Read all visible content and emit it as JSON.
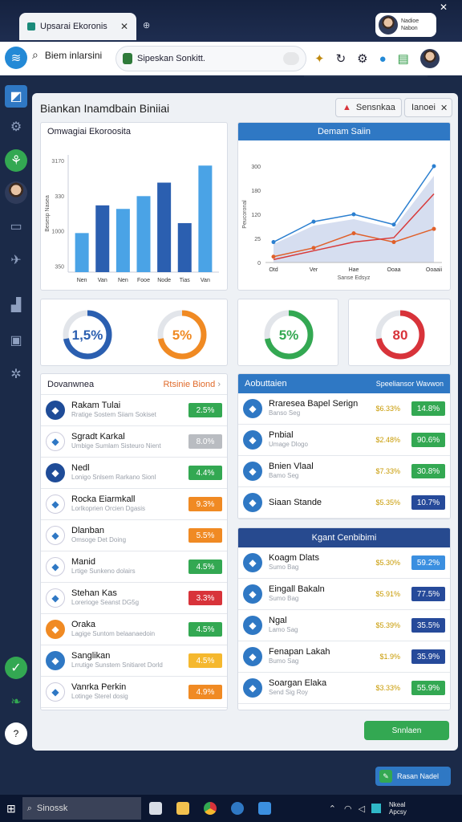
{
  "browser": {
    "tab_title": "Upsarai Ekoronis",
    "profile_name": "Nadioe",
    "profile_sub": "Nabon",
    "search_label": "Biem inlarsini",
    "omnibox_text": "Sipeskan Sonkitt."
  },
  "page": {
    "title": "Biankan Inamdbain Biniiai",
    "btn_one": "Sensnkaa",
    "btn_two": "Ianoei"
  },
  "bar_card": {
    "title": "Omwagiai Ekoroosita"
  },
  "line_card": {
    "title": "Demam Saiin"
  },
  "donuts": [
    {
      "label": "1,5%",
      "color": "#2b5fb0"
    },
    {
      "label": "5%",
      "color": "#f08a23"
    },
    {
      "label": "5%",
      "color": "#33a852"
    },
    {
      "label": "80",
      "color": "#d8333a"
    }
  ],
  "left_list": {
    "title": "Dovanwnea",
    "link": "Rtsinie  Biond",
    "rows": [
      {
        "name": "Rakam Tulai",
        "sub": "Rratige Sostem Siiam Sokiset",
        "value": "2.5%",
        "color": "green",
        "icon_bg": "#1f4c98"
      },
      {
        "name": "Sgradt Karkal",
        "sub": "Umbige Sumlam Sisteuro Nient",
        "value": "8.0%",
        "color": "gray",
        "icon_bg": "#ffffff"
      },
      {
        "name": "Nedl",
        "sub": "Lonigo Snlsem Rarkano Sionl",
        "value": "4.4%",
        "color": "green",
        "icon_bg": "#1f4c98"
      },
      {
        "name": "Rocka Eiarmkall",
        "sub": "Lorlkoprien Orcien Dgasis",
        "value": "9.3%",
        "color": "orange",
        "icon_bg": "#ffffff"
      },
      {
        "name": "Dlanban",
        "sub": "Omsoge Det Doing",
        "value": "5.5%",
        "color": "orange",
        "icon_bg": "#ffffff"
      },
      {
        "name": "Manid",
        "sub": "Lrtige Sunkeno dolairs",
        "value": "4.5%",
        "color": "green",
        "icon_bg": "#ffffff"
      },
      {
        "name": "Stehan Kas",
        "sub": "Lorerioge Seanst DG5g",
        "value": "3.3%",
        "color": "red",
        "icon_bg": "#ffffff"
      },
      {
        "name": "Oraka",
        "sub": "Lagige Suntom belaanaedoin",
        "value": "4.5%",
        "color": "green",
        "icon_bg": "#f08a23"
      },
      {
        "name": "Sanglikan",
        "sub": "Lrrutige Sunstem Snitiaret Dorld",
        "value": "4.5%",
        "color": "yellow",
        "icon_bg": "#2f78c4"
      },
      {
        "name": "Vanrka Perkin",
        "sub": "Lotinge Sterel dosig",
        "value": "4.9%",
        "color": "orange",
        "icon_bg": "#ffffff"
      }
    ]
  },
  "right_top_list": {
    "title": "Aobuttaien",
    "link": "Speeliansor Wavwon",
    "rows": [
      {
        "name": "Rraresea Bapel Serign",
        "sub": "Banso Seg",
        "pct": "$6.33%",
        "value": "14.8%",
        "color": "green"
      },
      {
        "name": "Pnbial",
        "sub": "Umage Dlogo",
        "pct": "$2.48%",
        "value": "90.6%",
        "color": "green"
      },
      {
        "name": "Bnien Vlaal",
        "sub": "Bamo Seg",
        "pct": "$7.33%",
        "value": "30.8%",
        "color": "green"
      },
      {
        "name": "Siaan Stande",
        "sub": "",
        "pct": "$5.35%",
        "value": "10.7%",
        "color": "navy"
      }
    ]
  },
  "right_bottom_list": {
    "title": "Kgant Cenbibimi",
    "rows": [
      {
        "name": "Koagm Dlats",
        "sub": "Sumo Bag",
        "pct": "$5.30%",
        "value": "59.2%",
        "color": "lblue"
      },
      {
        "name": "Eingall Bakaln",
        "sub": "Sumo Bag",
        "pct": "$5.91%",
        "value": "77.5%",
        "color": "navy"
      },
      {
        "name": "Ngal",
        "sub": "Lamo Sag",
        "pct": "$5.39%",
        "value": "35.5%",
        "color": "navy"
      },
      {
        "name": "Fenapan Lakah",
        "sub": "Bumo Sag",
        "pct": "$1.9%",
        "value": "35.9%",
        "color": "navy"
      },
      {
        "name": "Soargan Elaka",
        "sub": "Send Sig Roy",
        "pct": "$3.33%",
        "value": "55.9%",
        "color": "green"
      }
    ],
    "button": "Snnlaen"
  },
  "float_button": "Rasan Nadel",
  "taskbar": {
    "search": "Sinossk",
    "clock_line1": "Nkeal",
    "clock_line2": "Apcsy"
  },
  "chart_data": [
    {
      "type": "bar",
      "title": "Omwagiai Ekoroosita",
      "categories": [
        "Nen",
        "Van",
        "Nen",
        "Fooe",
        "Node",
        "Tias",
        "Van"
      ],
      "values": [
        1100,
        1880,
        1780,
        2140,
        2520,
        1380,
        3000
      ],
      "colors": [
        "#4aa3e6",
        "#2b5fb0",
        "#4aa3e6",
        "#4aa3e6",
        "#2b5fb0",
        "#2b5fb0",
        "#4aa3e6"
      ],
      "yticks": [
        "3170",
        "330",
        "1000",
        "350"
      ],
      "ylabel": "Besesp Nasea",
      "ylim": [
        0,
        3300
      ]
    },
    {
      "type": "line",
      "title": "Demam Saiin",
      "categories": [
        "Otd",
        "Ver",
        "Hae",
        "Ooaa",
        "Ooaaii"
      ],
      "xlabel": "Sanse Edsyz",
      "ylabel": "Peucoronal",
      "yticks": [
        "300",
        "180",
        "120",
        "25",
        "0"
      ],
      "ylim": [
        0,
        330
      ],
      "series": [
        {
          "color": "#2b7fd0",
          "values": [
            70,
            140,
            165,
            130,
            330
          ]
        },
        {
          "color": "#e0602a",
          "values": [
            20,
            50,
            100,
            70,
            115
          ]
        },
        {
          "color": "#d83a3a",
          "values": [
            10,
            40,
            70,
            85,
            235
          ]
        }
      ]
    }
  ]
}
